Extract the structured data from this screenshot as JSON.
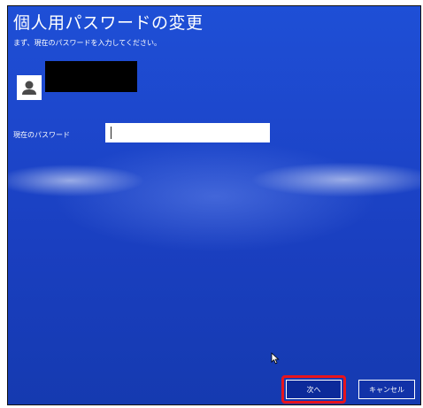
{
  "dialog": {
    "title": "個人用パスワードの変更",
    "subtitle": "まず、現在のパスワードを入力してください。"
  },
  "account": {
    "avatar_icon": "user-icon",
    "name_redacted": true
  },
  "password": {
    "label": "現在のパスワード",
    "value": ""
  },
  "buttons": {
    "next_label": "次へ",
    "cancel_label": "キャンセル"
  },
  "colors": {
    "background": "#1d47cc",
    "highlight": "#e8141c"
  }
}
